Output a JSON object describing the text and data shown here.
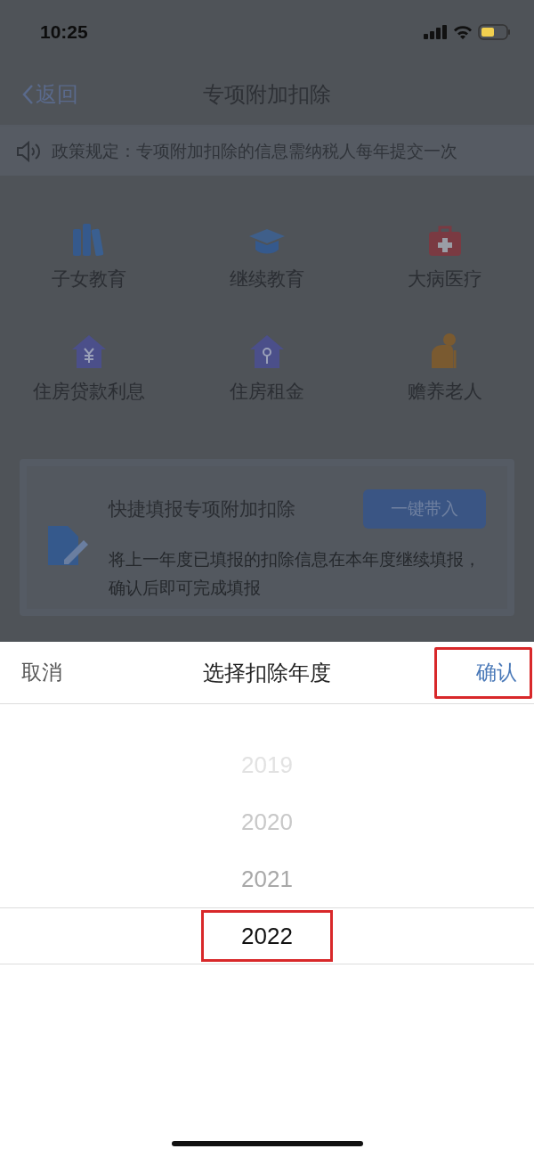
{
  "status_bar": {
    "time": "10:25"
  },
  "nav": {
    "back": "返回",
    "title": "专项附加扣除"
  },
  "notice": {
    "text": "政策规定：专项附加扣除的信息需纳税人每年提交一次"
  },
  "categories": [
    {
      "label": "子女教育"
    },
    {
      "label": "继续教育"
    },
    {
      "label": "大病医疗"
    },
    {
      "label": "住房贷款利息"
    },
    {
      "label": "住房租金"
    },
    {
      "label": "赡养老人"
    }
  ],
  "quick_fill": {
    "title": "快捷填报专项附加扣除",
    "button": "一键带入",
    "description": "将上一年度已填报的扣除信息在本年度继续填报，确认后即可完成填报"
  },
  "picker": {
    "cancel": "取消",
    "title": "选择扣除年度",
    "confirm": "确认",
    "confirm_highlighted": true,
    "options": [
      {
        "label": "2019",
        "selected": false,
        "highlighted": false
      },
      {
        "label": "2020",
        "selected": false,
        "highlighted": false
      },
      {
        "label": "2021",
        "selected": false,
        "highlighted": false
      },
      {
        "label": "2022",
        "selected": true,
        "highlighted": true
      }
    ]
  }
}
